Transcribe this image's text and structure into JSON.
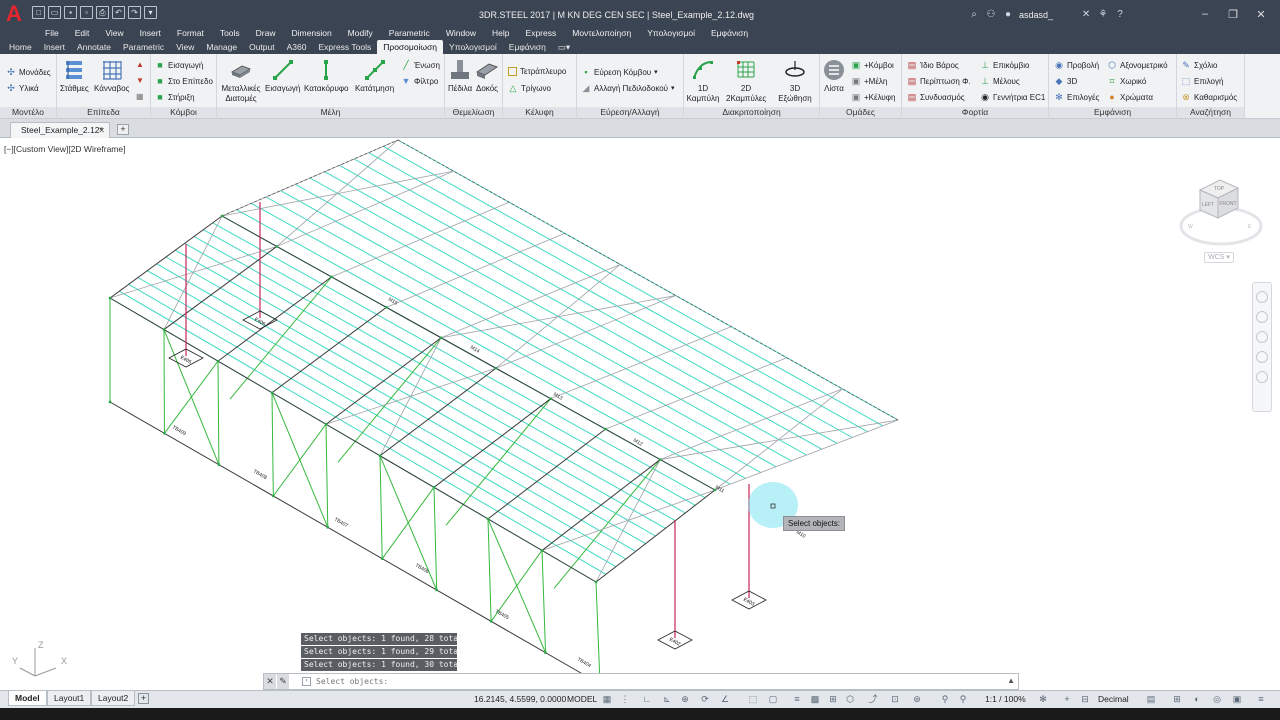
{
  "title_bar": {
    "title": "3DR.STEEL 2017  |  M KN DEG CEN SEC  |    Steel_Example_2.12.dwg",
    "user": "asdasd_",
    "logo": "A"
  },
  "menu": [
    "File",
    "Edit",
    "View",
    "Insert",
    "Format",
    "Tools",
    "Draw",
    "Dimension",
    "Modify",
    "Parametric",
    "Window",
    "Help",
    "Express",
    "Μοντελοποίηση",
    "Υπολογισμοί",
    "Εμφάνιση"
  ],
  "ribbon_tabs": [
    "Home",
    "Insert",
    "Annotate",
    "Parametric",
    "View",
    "Manage",
    "Output",
    "A360",
    "Express Tools",
    "Προσομοίωση",
    "Υπολογισμοί",
    "Εμφάνιση"
  ],
  "ribbon_active_tab": "Προσομοίωση",
  "ribbon": {
    "model": {
      "title": "Μοντέλο",
      "items": [
        "Μονάδες",
        "Υλικά"
      ]
    },
    "levels": {
      "title": "Επίπεδα",
      "items": [
        "Στάθμες",
        "Κάνναβος"
      ]
    },
    "nodes": {
      "title": "Κόμβοι",
      "items": [
        "Εισαγωγή",
        "Στο Επίπεδο",
        "Στήριξη"
      ]
    },
    "members": {
      "title": "Μέλη",
      "items": [
        "Μεταλλικές Διατομές",
        "Εισαγωγή",
        "Κατακόρυφο",
        "Κατάτμηση",
        "Ένωση",
        "Φίλτρο"
      ]
    },
    "foundation": {
      "title": "Θεμελίωση",
      "items": [
        "Πέδιλα",
        "Δοκός"
      ]
    },
    "shell": {
      "title": "Κέλυφη",
      "items": [
        "Τετράπλευρο",
        "Τρίγωνο"
      ]
    },
    "width": {
      "title": "Εύρεση/Αλλαγή",
      "items": [
        "Εύρεση Κόμβου",
        "Αλλαγή Πεδιλοδοκού"
      ]
    },
    "discretize": {
      "title": "Διακριτοποίηση",
      "items": [
        "1D Καμπύλη",
        "2D 2Καμπύλες",
        "3D Εξώθηση"
      ]
    },
    "groups": {
      "title": "Ομάδες",
      "items": [
        "Λίστα",
        "+Κόμβοι",
        "+Μέλη",
        "+Κέλυφη"
      ]
    },
    "loads": {
      "title": "Φορτία",
      "items": [
        "Ίδιο Βάρος",
        "Περίπτωση Φ.",
        "Συνδυασμός",
        "Επικόμβιο",
        "Μέλους",
        "Γεννήτρια EC1"
      ]
    },
    "display": {
      "title": "Εμφάνιση",
      "items": [
        "Προβολή",
        "3D",
        "Επιλογές",
        "Αξονομετρικό",
        "Χωρικό",
        "Χρώματα"
      ]
    },
    "search": {
      "title": "Αναζήτηση",
      "items": [
        "Σχόλιο",
        "Επιλογή",
        "Καθαρισμός"
      ]
    }
  },
  "doc_tab": {
    "name": "Steel_Example_2.12*"
  },
  "viewport": {
    "view_label": "[−][Custom View][2D Wireframe]",
    "wcs_label": "WCS",
    "viewcube_faces": [
      "TOP",
      "LEFT",
      "FRONT"
    ],
    "tooltip": "Select objects:",
    "ucs_labels": [
      "Z",
      "Y",
      "X"
    ],
    "member_labels": [
      "Μ15",
      "Μ14",
      "Μ13",
      "Μ12",
      "Μ11",
      "Μ10",
      "ΤΒ409",
      "ΤΒ408",
      "ΤΒ407",
      "ΤΒ406",
      "ΤΒ405",
      "ΤΒ404"
    ],
    "support_labels": [
      "Ε405",
      "Ε406",
      "Ε403",
      "Ε402"
    ]
  },
  "command": {
    "history": [
      "Select objects: 1 found, 28 total",
      "Select objects: 1 found, 29 total",
      "Select objects: 1 found, 30 total"
    ],
    "prompt": "Select objects:"
  },
  "status": {
    "layouts": [
      "Model",
      "Layout1",
      "Layout2"
    ],
    "coords": "16.2145, 4.5599, 0.0000",
    "space": "MODEL",
    "scale": "1:1 / 100%",
    "units": "Decimal"
  }
}
